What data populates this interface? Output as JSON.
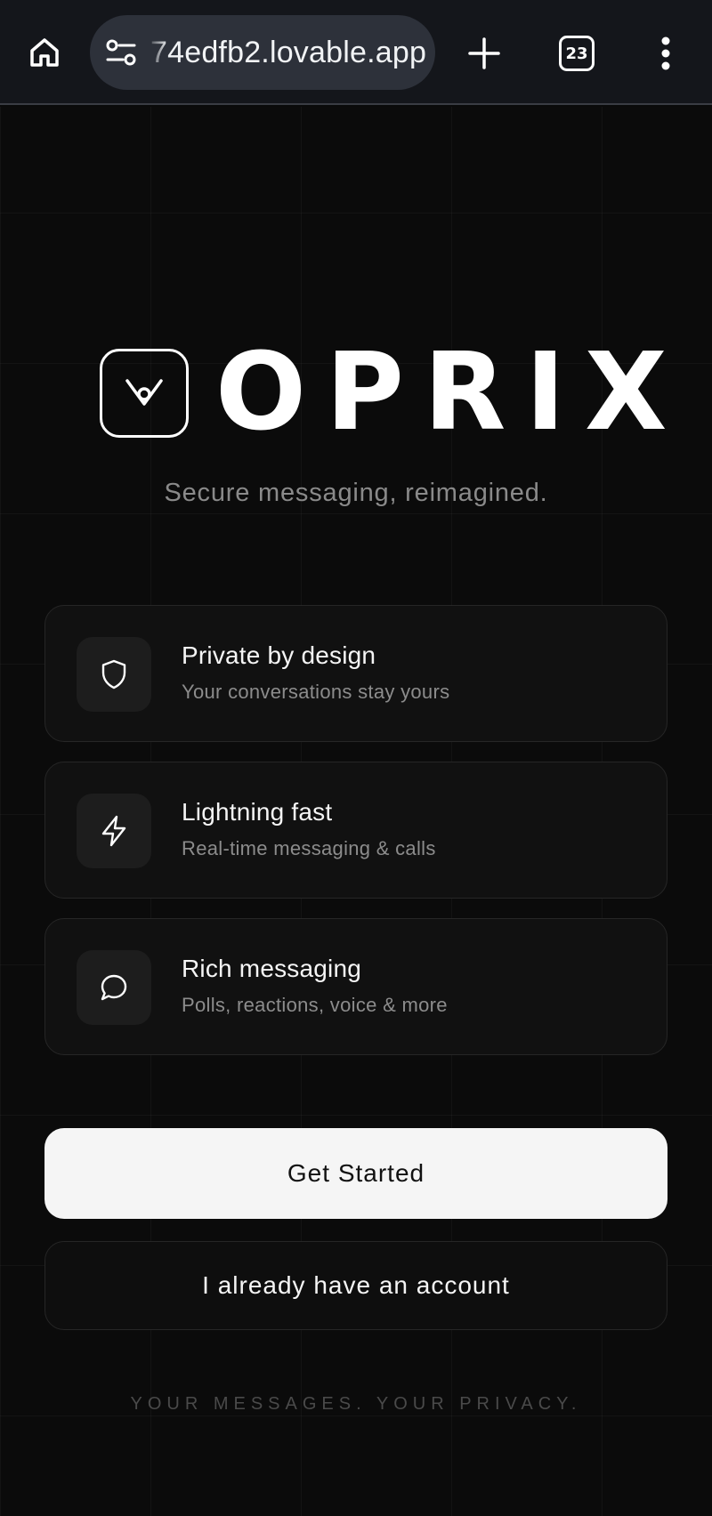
{
  "browser": {
    "url": "74edfb2.lovable.app",
    "tab_count": "23",
    "icons": {
      "home": "home-icon",
      "site_info": "site-settings-icon",
      "new_tab": "plus-icon",
      "tabs": "tab-switcher-icon",
      "menu": "more-vertical-icon"
    }
  },
  "brand": {
    "name": "OPRIX",
    "tagline": "Secure messaging, reimagined."
  },
  "features": [
    {
      "icon": "shield-icon",
      "title": "Private by design",
      "subtitle": "Your conversations stay yours"
    },
    {
      "icon": "lightning-icon",
      "title": "Lightning fast",
      "subtitle": "Real-time messaging & calls"
    },
    {
      "icon": "chat-bubble-icon",
      "title": "Rich messaging",
      "subtitle": "Polls, reactions, voice & more"
    }
  ],
  "actions": {
    "primary_label": "Get Started",
    "secondary_label": "I already have an account"
  },
  "footer": {
    "note": "YOUR MESSAGES. YOUR PRIVACY."
  },
  "colors": {
    "background": "#0b0b0b",
    "card": "#111111",
    "primary_button": "#f5f5f5",
    "muted_text": "#8c8c8c"
  }
}
